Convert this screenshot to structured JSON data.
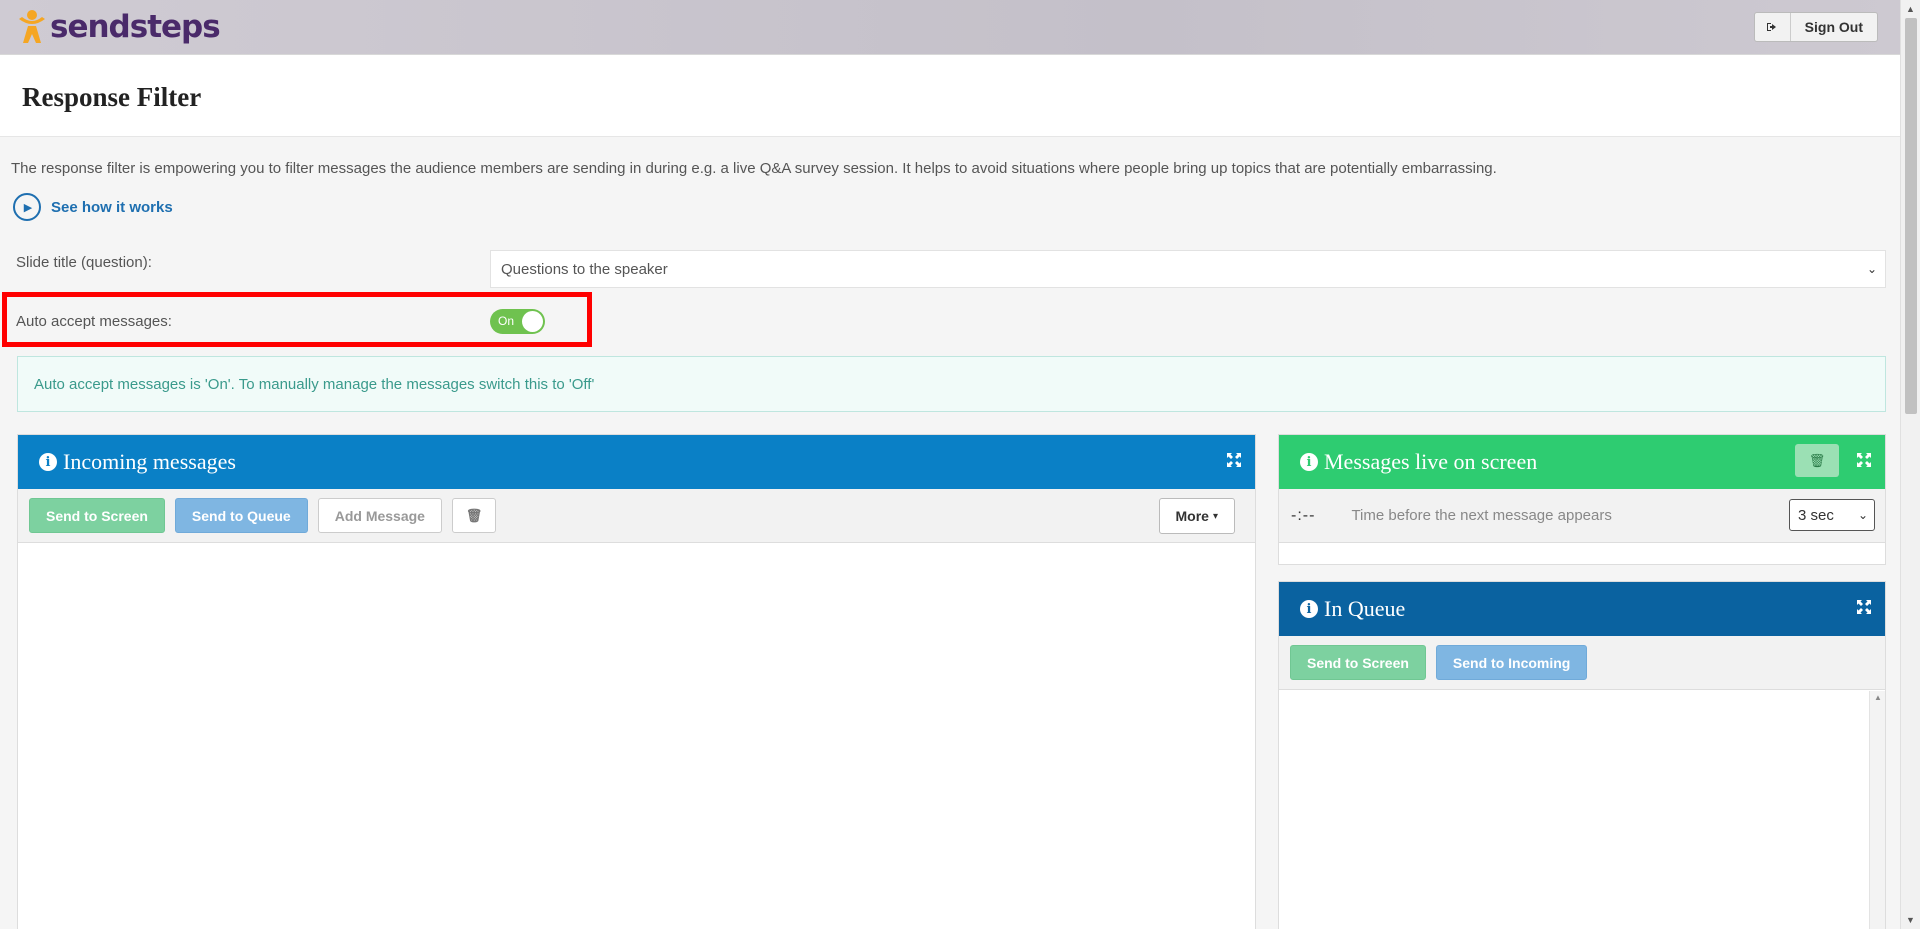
{
  "app": {
    "logo_text": "sendsteps",
    "signout_label": "Sign Out",
    "page_title": "Response Filter"
  },
  "intro": {
    "text": "The response filter is empowering you to filter messages the audience members are sending in during e.g. a live Q&A survey session. It helps to avoid situations where people bring up topics that are potentially embarrassing.",
    "howto_label": "See how it works"
  },
  "form": {
    "slide_label": "Slide title (question):",
    "slide_value": "Questions to the speaker",
    "auto_accept_label": "Auto accept messages:",
    "auto_accept_state": "On",
    "alert_text": "Auto accept messages is 'On'. To manually manage the messages switch this to 'Off'"
  },
  "incoming": {
    "title": "Incoming messages",
    "send_screen": "Send to Screen",
    "send_queue": "Send to Queue",
    "add_message": "Add Message",
    "more": "More"
  },
  "live": {
    "title": "Messages live on screen",
    "timer_icon_text": "-:--",
    "timer_label": "Time before the next message appears",
    "timer_value": "3 sec"
  },
  "queue": {
    "title": "In Queue",
    "send_screen": "Send to Screen",
    "send_incoming": "Send to Incoming"
  },
  "colors": {
    "incoming_header": "#0a80c6",
    "live_header": "#2ecc71",
    "queue_header": "#0a62a0",
    "toggle_on": "#6fc24f",
    "highlight": "#ff0000"
  }
}
